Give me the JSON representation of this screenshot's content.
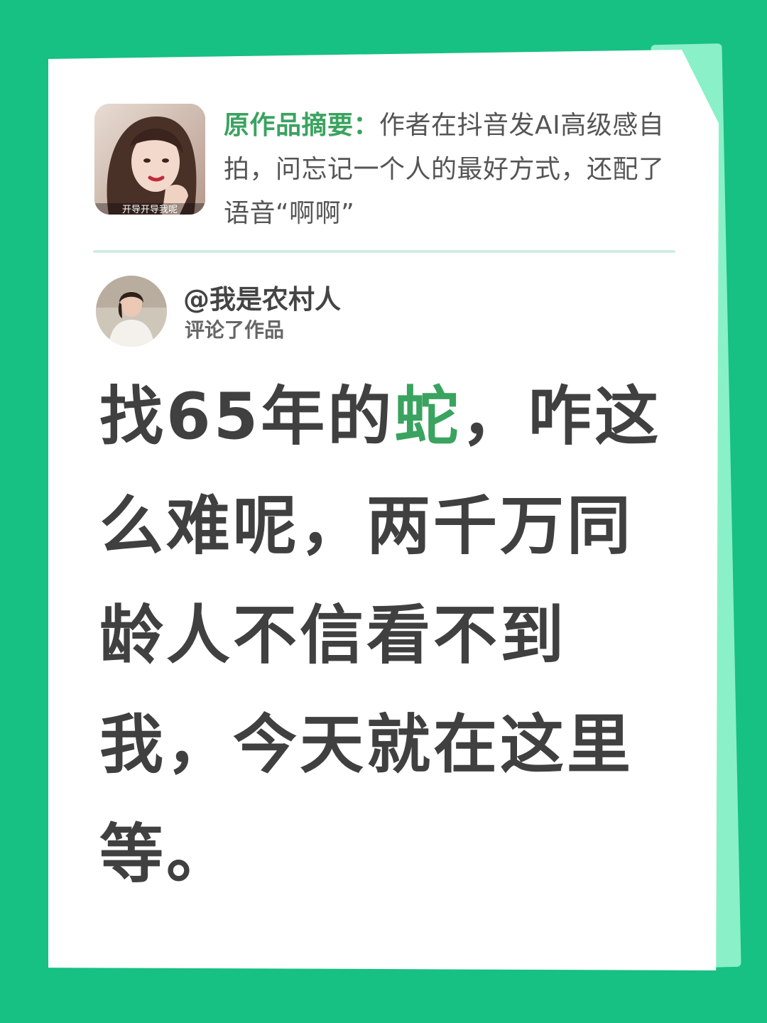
{
  "summary": {
    "label": "原作品摘要：",
    "text": "作者在抖音发AI高级感自拍，问忘记一个人的最好方式，还配了语音“啊啊”"
  },
  "thumbnail": {
    "icon": "portrait-photo",
    "caption": "开导开导我呢"
  },
  "commenter": {
    "name": "@我是农村人",
    "action": "评论了作品",
    "avatar_icon": "user-avatar-photo"
  },
  "comment": {
    "before": "找65年的",
    "highlight": "蛇",
    "after": "，咋这么难呢，两千万同龄人不信看不到我，今天就在这里等。"
  },
  "colors": {
    "background": "#17c083",
    "accent": "#3aa35f",
    "text": "#404040"
  }
}
